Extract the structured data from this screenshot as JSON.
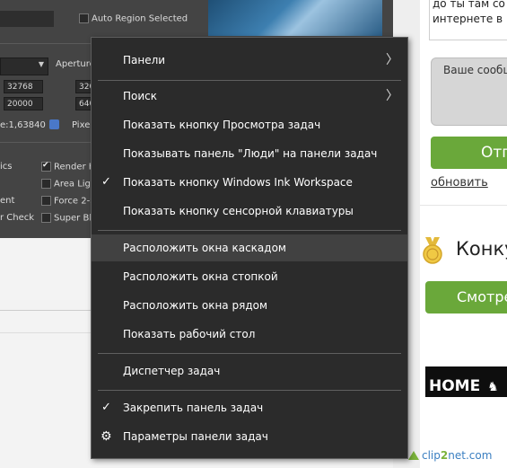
{
  "left_app": {
    "auto_region_label": "Auto Region Selected",
    "aperture_label": "Aperture",
    "field_1": "32768",
    "field_2": "20000",
    "field_3": "320",
    "field_4": "640",
    "ratio_text": "e:1,63840",
    "pixel_label": "Pixel",
    "render_hidden_label": "Render Hi",
    "area_lights_label": "Area Light",
    "force_2sided_label": "Force 2-Si",
    "super_black_label": "Super Blac",
    "partial_ics": "ics",
    "partial_ent": "ent",
    "partial_check": "r Check"
  },
  "context_menu": {
    "items": [
      {
        "label": "Панели",
        "submenu": true
      },
      {
        "label": "Поиск",
        "submenu": true
      },
      {
        "label": "Показать кнопку Просмотра задач"
      },
      {
        "label": "Показывать панель \"Люди\" на панели задач"
      },
      {
        "label": "Показать кнопку Windows Ink Workspace",
        "checked": true
      },
      {
        "label": "Показать кнопку сенсорной клавиатуры"
      },
      {
        "label": "Расположить окна каскадом",
        "highlighted": true
      },
      {
        "label": "Расположить окна стопкой"
      },
      {
        "label": "Расположить окна рядом"
      },
      {
        "label": "Показать рабочий стол"
      },
      {
        "label": "Диспетчер задач"
      },
      {
        "label": "Закрепить панель задач",
        "checked": true
      },
      {
        "label": "Параметры панели задач",
        "icon": "gear-icon"
      }
    ]
  },
  "web": {
    "notice_text": "до ты там сочинернете в",
    "notice_line1": "до ты там со",
    "notice_line2": "интернете в",
    "message_placeholder": "Ваше сообщ",
    "send_button": "Отп",
    "refresh_link": "обновить",
    "contest_title": "Конку",
    "watch_button": "Смотре",
    "banner_text": "HOME"
  },
  "watermark": {
    "text_a": "clip",
    "text_b": "2",
    "text_c": "net.com"
  },
  "colors": {
    "menu_bg": "#2b2b2b",
    "menu_hover": "#414141",
    "accent_green": "#6aa83a"
  }
}
